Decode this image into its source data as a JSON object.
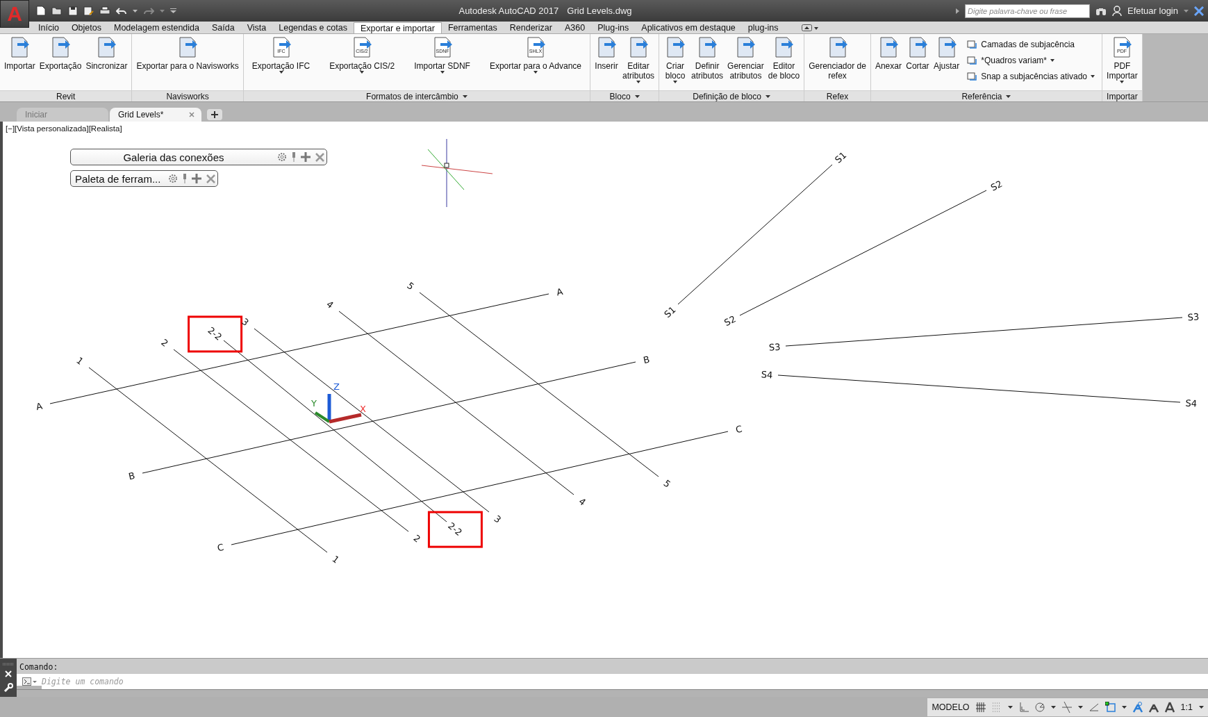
{
  "title_bar": {
    "app_logo": "A",
    "app_name": "Autodesk AutoCAD 2017",
    "file_name": "Grid Levels.dwg",
    "search": {
      "placeholder": "Digite palavra-chave ou frase"
    },
    "login": "Efetuar login"
  },
  "menu_tabs": [
    {
      "label": "Início",
      "selected": false
    },
    {
      "label": "Objetos",
      "selected": false
    },
    {
      "label": "Modelagem estendida",
      "selected": false
    },
    {
      "label": "Saída",
      "selected": false
    },
    {
      "label": "Vista",
      "selected": false
    },
    {
      "label": "Legendas e cotas",
      "selected": false
    },
    {
      "label": "Exportar e importar",
      "selected": true
    },
    {
      "label": "Ferramentas",
      "selected": false
    },
    {
      "label": "Renderizar",
      "selected": false
    },
    {
      "label": "A360",
      "selected": false
    },
    {
      "label": "Plug-ins",
      "selected": false
    },
    {
      "label": "Aplicativos em destaque",
      "selected": false
    },
    {
      "label": "plug-ins",
      "selected": false
    }
  ],
  "ribbon_panels": [
    {
      "title": "Revit",
      "title_dropdown": false,
      "buttons": [
        {
          "label": "Importar",
          "dropdown": false
        },
        {
          "label": "Exportação",
          "dropdown": false
        },
        {
          "label": "Sincronizar",
          "dropdown": false
        }
      ]
    },
    {
      "title": "Navisworks",
      "title_dropdown": false,
      "buttons": [
        {
          "label": "Exportar para o Navisworks",
          "dropdown": false
        }
      ]
    },
    {
      "title": "Formatos de intercâmbio",
      "title_dropdown": true,
      "buttons": [
        {
          "label": "Exportação IFC",
          "badge": "IFC",
          "dropdown": true
        },
        {
          "label": "Exportação CIS/2",
          "badge": "CIS/2",
          "dropdown": true
        },
        {
          "label": "Importar SDNF",
          "badge": "SDNF",
          "dropdown": true
        },
        {
          "label": "Exportar para o Advance",
          "badge": "SHLX",
          "dropdown": true
        }
      ]
    },
    {
      "title": "Bloco",
      "title_dropdown": true,
      "buttons": [
        {
          "label": "Inserir",
          "dropdown": false
        },
        {
          "label": "Editar\natributos",
          "dropdown": true
        }
      ]
    },
    {
      "title": "Definição de bloco",
      "title_dropdown": true,
      "buttons": [
        {
          "label": "Criar\nbloco",
          "dropdown": true
        },
        {
          "label": "Definir\natributos",
          "dropdown": false
        },
        {
          "label": "Gerenciar\natributos",
          "dropdown": false
        },
        {
          "label": "Editor\nde bloco",
          "dropdown": false
        }
      ]
    },
    {
      "title": "Refex",
      "title_dropdown": false,
      "buttons": [
        {
          "label": "Gerenciador de\nrefex",
          "dropdown": false
        }
      ]
    },
    {
      "title": "Referência",
      "title_dropdown": true,
      "buttons": [
        {
          "label": "Anexar",
          "dropdown": false
        },
        {
          "label": "Cortar",
          "dropdown": false
        },
        {
          "label": "Ajustar",
          "dropdown": false
        }
      ],
      "small_buttons": [
        {
          "label": "Camadas de subjacência",
          "dropdown": false
        },
        {
          "label": "*Quadros variam*",
          "dropdown": true
        },
        {
          "label": "Snap a subjacências ativado",
          "dropdown": true
        }
      ]
    },
    {
      "title": "Importar",
      "title_dropdown": false,
      "buttons": [
        {
          "label": "PDF\nImportar",
          "badge": "PDF",
          "dropdown": true
        }
      ]
    }
  ],
  "file_tabs": [
    {
      "label": "Iniciar",
      "selected": false
    },
    {
      "label": "Grid Levels*",
      "selected": true
    }
  ],
  "viewport_label": "[−][Vista personalizada][Realista]",
  "palettes": [
    {
      "title": "Galeria das conexões"
    },
    {
      "title": "Paleta de ferram..."
    }
  ],
  "grid_lines": [
    {
      "start_label": "A",
      "end_label": "A",
      "highlighted": false
    },
    {
      "start_label": "B",
      "end_label": "B",
      "highlighted": false
    },
    {
      "start_label": "C",
      "end_label": "C",
      "highlighted": false
    },
    {
      "start_label": "1",
      "end_label": "1",
      "highlighted": false
    },
    {
      "start_label": "2",
      "end_label": "2",
      "highlighted": false
    },
    {
      "start_label": "2-2",
      "end_label": "2-2",
      "highlighted": true
    },
    {
      "start_label": "3",
      "end_label": "3",
      "highlighted": false
    },
    {
      "start_label": "4",
      "end_label": "4",
      "highlighted": false
    },
    {
      "start_label": "5",
      "end_label": "5",
      "highlighted": false
    },
    {
      "start_label": "S1",
      "end_label": "S1",
      "highlighted": false
    },
    {
      "start_label": "S2",
      "end_label": "S2",
      "highlighted": false
    },
    {
      "start_label": "S3",
      "end_label": "S3",
      "highlighted": false
    },
    {
      "start_label": "S4",
      "end_label": "S4",
      "highlighted": false
    }
  ],
  "ucs": {
    "x": "X",
    "y": "Y",
    "z": "Z"
  },
  "command_line": {
    "history": "Comando:",
    "placeholder": "Digite um comando"
  },
  "status_bar": {
    "mode": "MODELO",
    "scale": "1:1"
  }
}
